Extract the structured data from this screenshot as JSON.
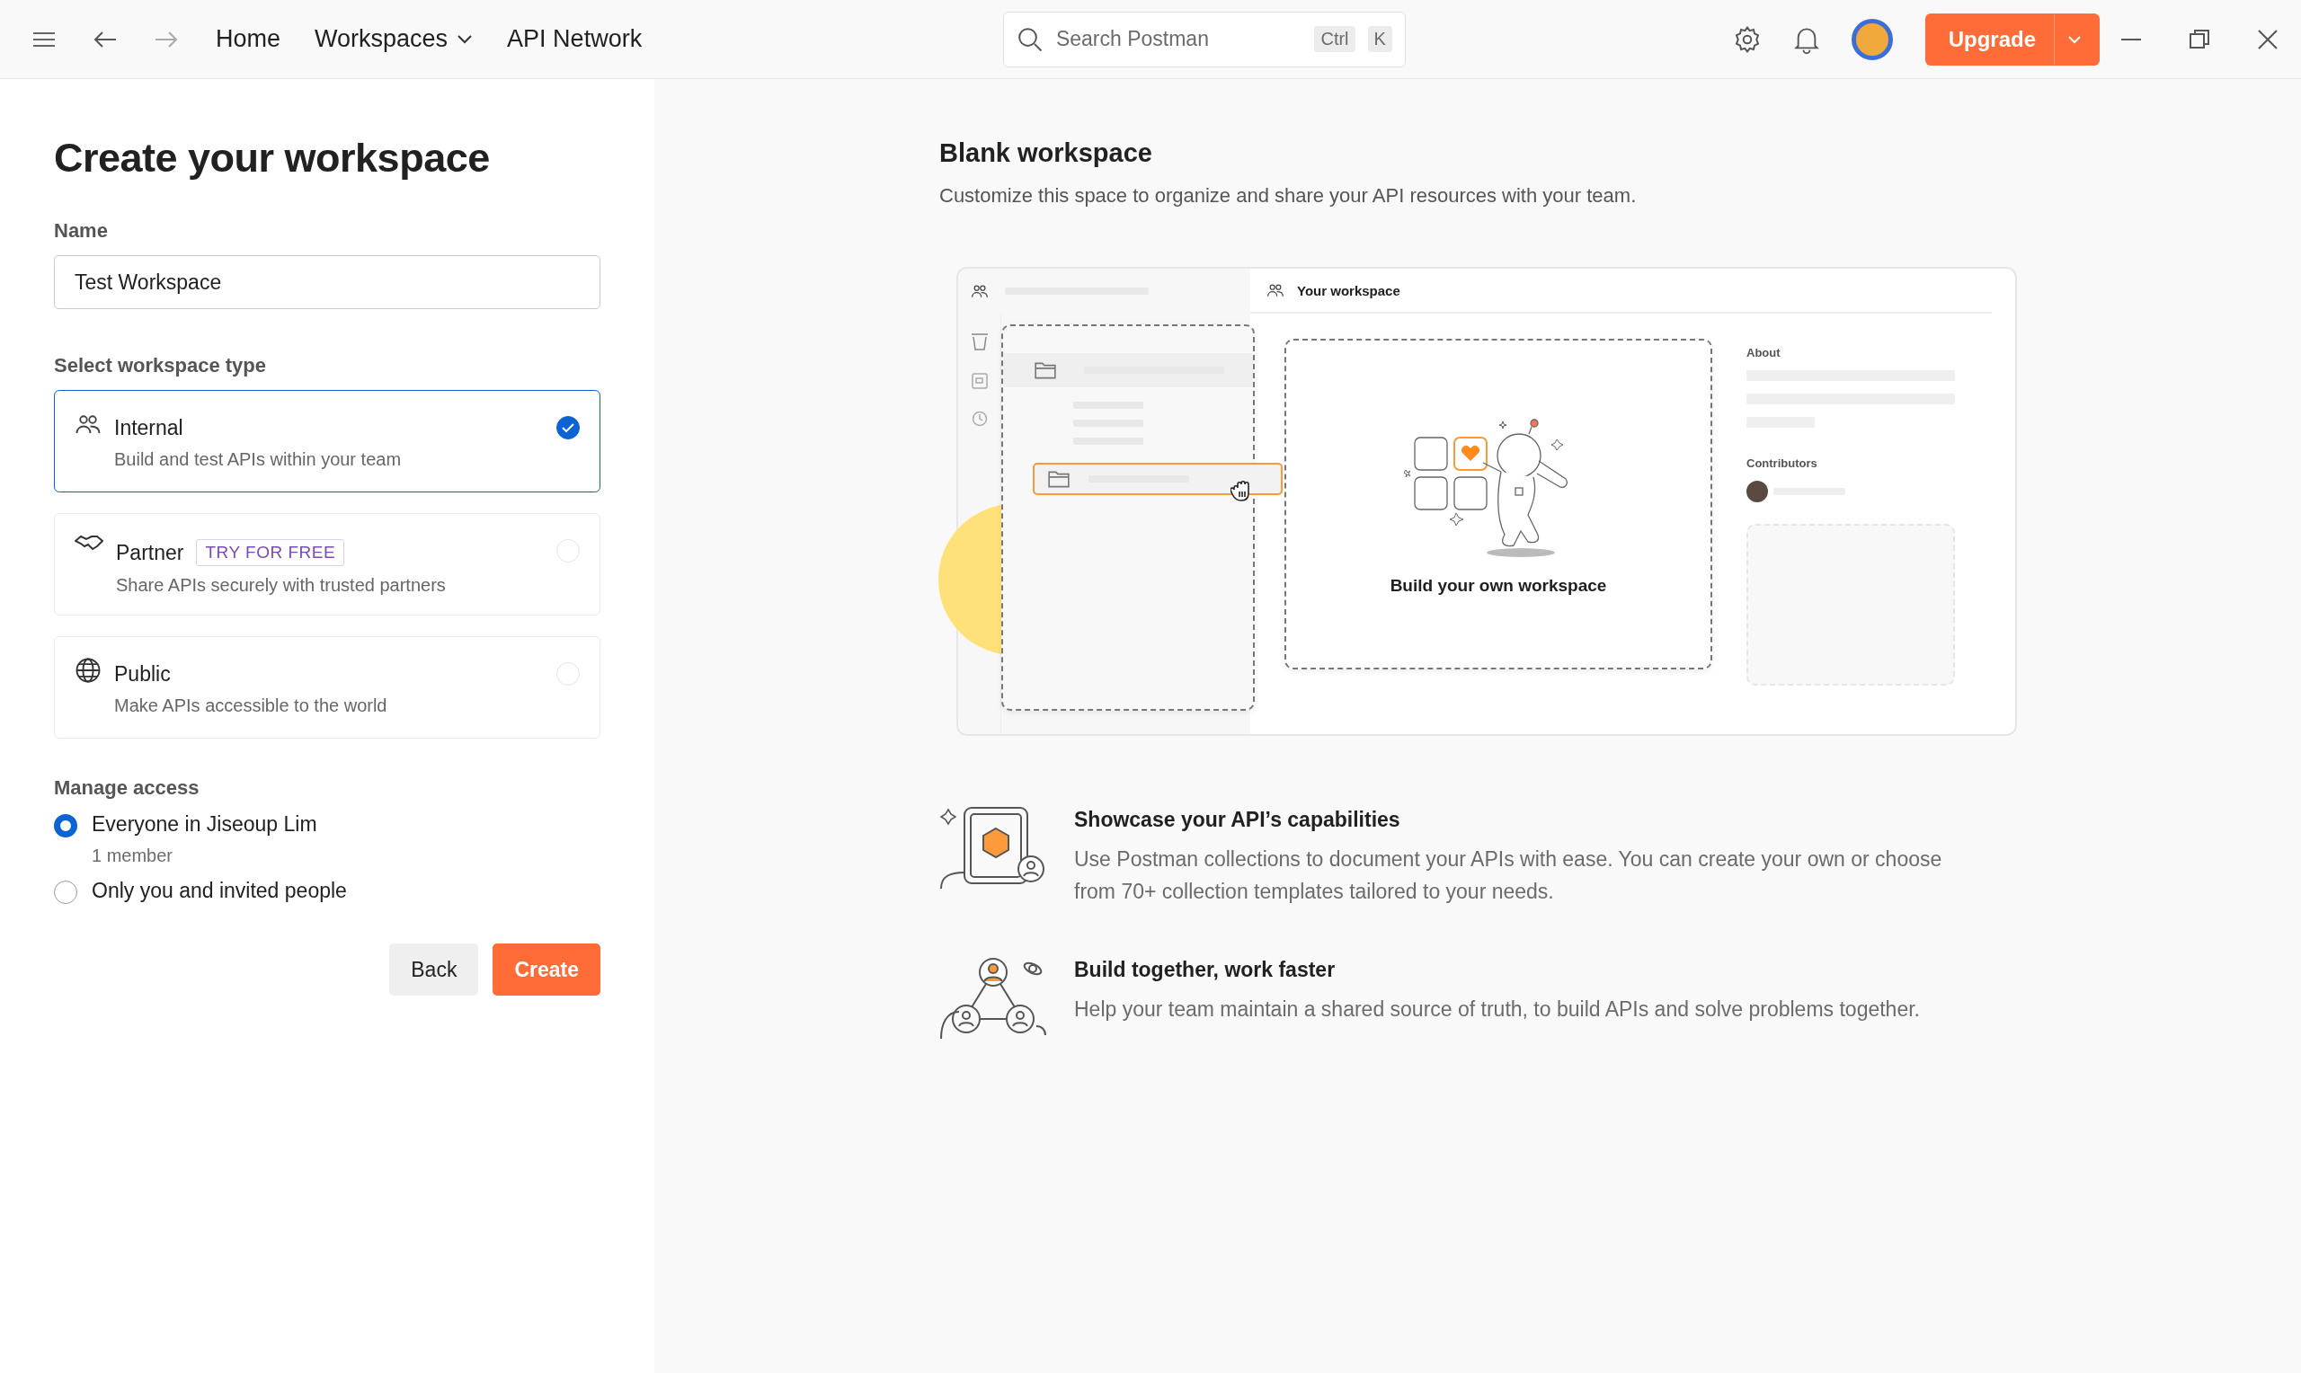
{
  "topbar": {
    "nav": [
      {
        "label": "Home",
        "dropdown": false
      },
      {
        "label": "Workspaces",
        "dropdown": true
      },
      {
        "label": "API Network",
        "dropdown": false
      }
    ],
    "search": {
      "placeholder": "Search Postman",
      "keys": [
        "Ctrl",
        "K"
      ]
    },
    "upgrade": "Upgrade"
  },
  "form": {
    "title": "Create your workspace",
    "name_label": "Name",
    "name_value": "Test Workspace",
    "type_label": "Select workspace type",
    "types": [
      {
        "kind": "internal",
        "label": "Internal",
        "description": "Build and test APIs within your team",
        "selected": true
      },
      {
        "kind": "partner",
        "label": "Partner",
        "badge": "TRY FOR FREE",
        "description": "Share APIs securely with trusted partners",
        "selected": false
      },
      {
        "kind": "public",
        "label": "Public",
        "description": "Make APIs accessible to the world",
        "selected": false
      }
    ],
    "access_label": "Manage access",
    "access": [
      {
        "label": "Everyone in Jiseoup Lim",
        "sublabel": "1 member",
        "selected": true
      },
      {
        "label": "Only you and invited people",
        "selected": false
      }
    ],
    "buttons": [
      {
        "kind": "secondary",
        "label": "Back"
      },
      {
        "kind": "primary",
        "label": "Create"
      }
    ]
  },
  "preview": {
    "title": "Blank workspace",
    "description": "Customize this space to organize and share your API resources with your team.",
    "illustration": {
      "header": "Your workspace",
      "caption": "Build your own workspace",
      "about": "About",
      "contributors": "Contributors"
    },
    "features": [
      {
        "kind": "showcase",
        "title": "Showcase your API’s capabilities",
        "description": "Use Postman collections to document your APIs with ease. You can create your own or choose from 70+ collection templates tailored to your needs."
      },
      {
        "kind": "team",
        "title": "Build together, work faster",
        "description": "Help your team maintain a shared source of truth, to build APIs and solve problems together."
      }
    ]
  }
}
